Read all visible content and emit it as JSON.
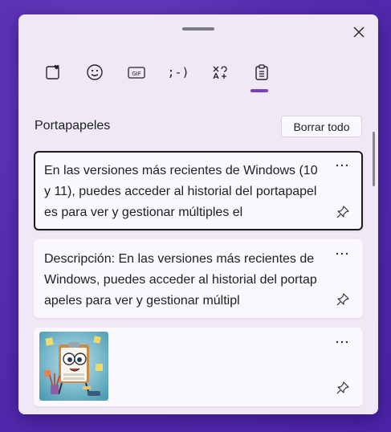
{
  "panel": {
    "section_title": "Portapapeles",
    "clear_button": "Borrar todo"
  },
  "toolbar": {
    "tabs": [
      {
        "name": "emoji-favorites-icon"
      },
      {
        "name": "emoji-icon"
      },
      {
        "name": "gif-icon",
        "label": "GIF"
      },
      {
        "name": "kaomoji-icon",
        "label": ";-)"
      },
      {
        "name": "symbols-icon"
      },
      {
        "name": "clipboard-icon",
        "active": true
      }
    ]
  },
  "clipboard_items": [
    {
      "type": "text",
      "selected": true,
      "text": "En las versiones más recientes de Windows (10 y 11), puedes acceder al historial del portapapeles para ver y gestionar múltiples el"
    },
    {
      "type": "text",
      "selected": false,
      "text": "Descripción: En las versiones más recientes de Windows, puedes acceder al historial del portapapeles para ver y gestionar múltipl"
    },
    {
      "type": "image",
      "selected": false,
      "image_subject": "cartoon clipboard character illustration"
    }
  ],
  "colors": {
    "background": "#5a2fb3",
    "panel": "#efe9f7",
    "accent": "#7b3fbf",
    "card": "#faf7fd"
  }
}
